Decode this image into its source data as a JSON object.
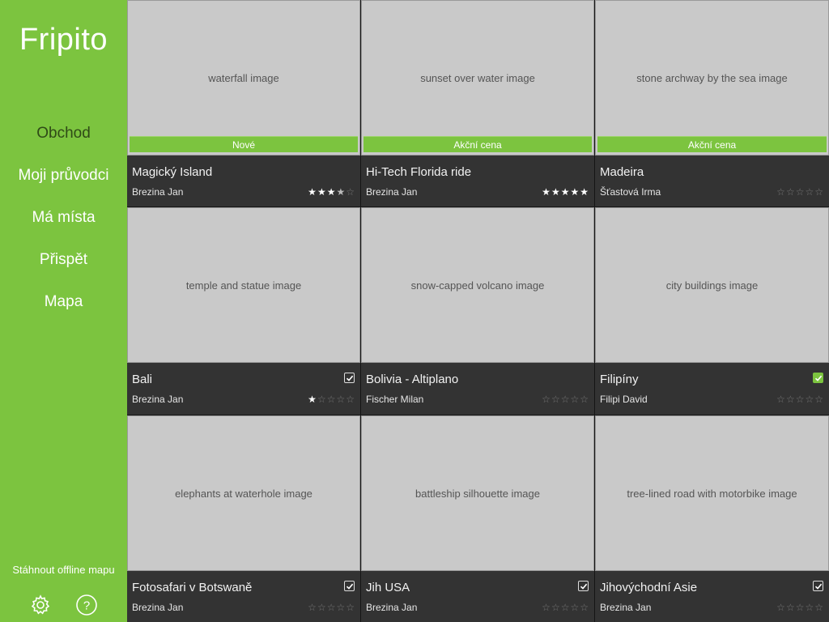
{
  "app": {
    "title": "Fripito"
  },
  "nav": [
    {
      "label": "Obchod",
      "active": true
    },
    {
      "label": "Moji průvodci",
      "active": false
    },
    {
      "label": "Má místa",
      "active": false
    },
    {
      "label": "Přispět",
      "active": false
    },
    {
      "label": "Mapa",
      "active": false
    }
  ],
  "footer": {
    "offline_label": "Stáhnout offline mapu"
  },
  "icons": {
    "settings": "gear-icon",
    "help": "help-icon"
  },
  "colors": {
    "accent": "#7cc43f",
    "tile_bg": "#333333",
    "active_nav": "#2f4a17"
  },
  "guides": [
    {
      "title": "Magický Island",
      "author": "Brezina Jan",
      "badge": "Nové",
      "rating": 3.5,
      "checked": null,
      "photo": "waterfall image"
    },
    {
      "title": "Hi-Tech Florida ride",
      "author": "Brezina Jan",
      "badge": "Akční cena",
      "rating": 5,
      "checked": null,
      "photo": "sunset over water image"
    },
    {
      "title": "Madeira",
      "author": "Šťastová Irma",
      "badge": "Akční cena",
      "rating": 0,
      "checked": null,
      "photo": "stone archway by the sea image"
    },
    {
      "title": "Bali",
      "author": "Brezina Jan",
      "badge": "",
      "rating": 1,
      "checked": "white",
      "photo": "temple and statue image"
    },
    {
      "title": "Bolivia - Altiplano",
      "author": "Fischer Milan",
      "badge": "",
      "rating": 0,
      "checked": null,
      "photo": "snow-capped volcano image"
    },
    {
      "title": "Filipíny",
      "author": "Filipi David",
      "badge": "",
      "rating": 0,
      "checked": "green",
      "photo": "city buildings image"
    },
    {
      "title": "Fotosafari v Botswaně",
      "author": "Brezina Jan",
      "badge": "",
      "rating": 0,
      "checked": "white",
      "photo": "elephants at waterhole image"
    },
    {
      "title": "Jih USA",
      "author": "Brezina Jan",
      "badge": "",
      "rating": 0,
      "checked": "white",
      "photo": "battleship silhouette image"
    },
    {
      "title": "Jihovýchodní Asie",
      "author": "Brezina Jan",
      "badge": "",
      "rating": 0,
      "checked": "white",
      "photo": "tree-lined road with motorbike image"
    }
  ]
}
